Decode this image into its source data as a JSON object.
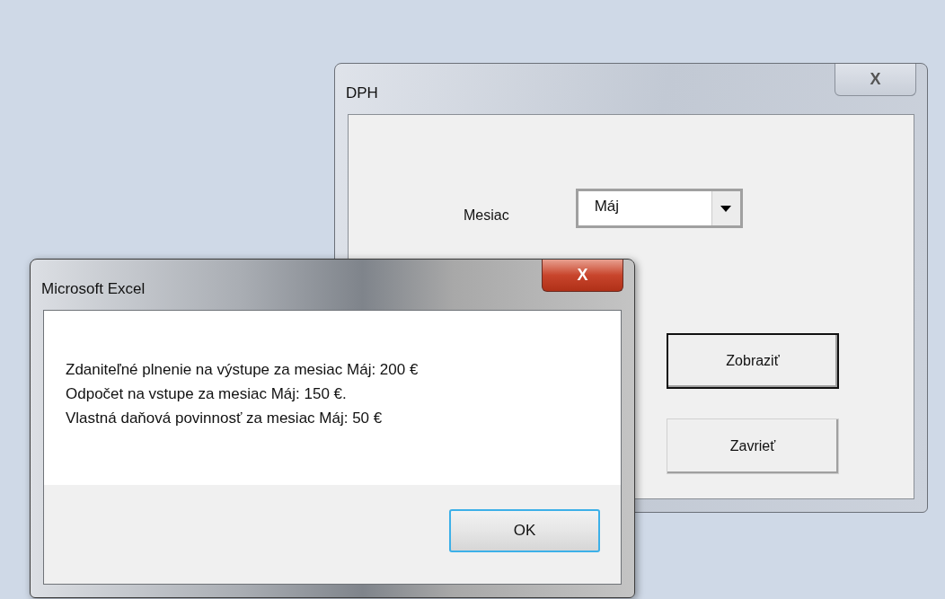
{
  "windows": [
    {
      "title": "DPH",
      "active": false,
      "close_label": "X",
      "fields": [
        {
          "label": "Mesiac",
          "value": "Máj"
        }
      ],
      "buttons": [
        {
          "label": "Zobraziť",
          "default": true
        },
        {
          "label": "Zavrieť",
          "default": false
        }
      ]
    },
    {
      "title": "Microsoft Excel",
      "active": true,
      "close_label": "X",
      "message": [
        "Zdaniteľné plnenie na výstupe za mesiac Máj: 200 €",
        "Odpočet na vstupe za mesiac Máj: 150 €.",
        "Vlastná daňová povinnosť za mesiac Máj: 50 €"
      ],
      "buttons": [
        {
          "label": "OK",
          "focused": true
        }
      ]
    }
  ]
}
